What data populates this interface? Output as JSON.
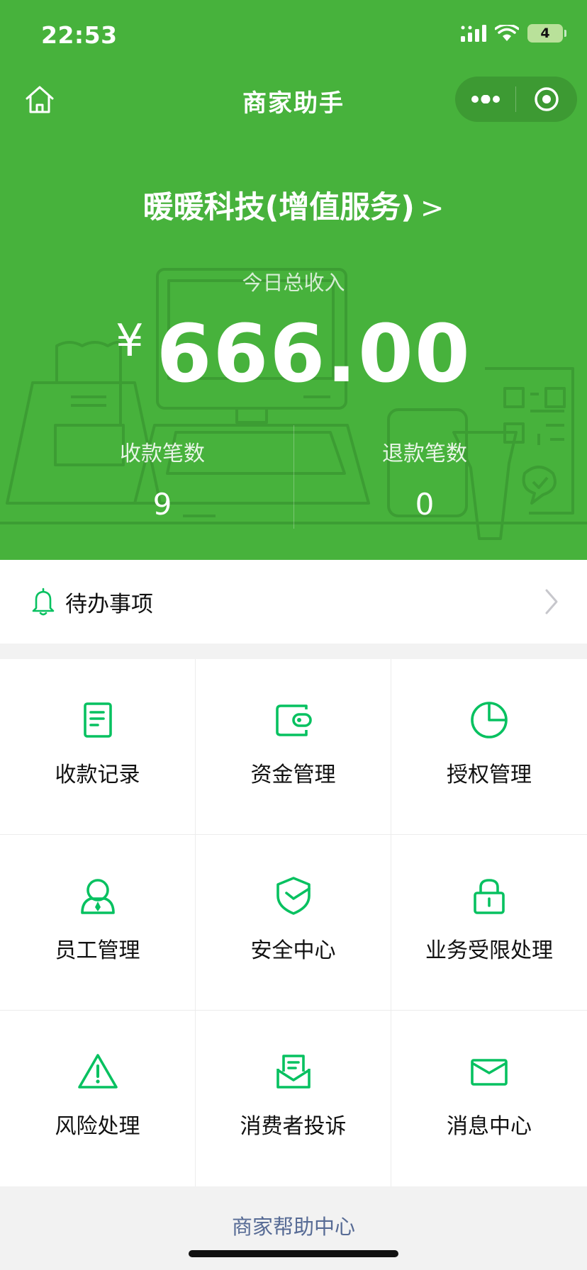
{
  "status_bar": {
    "time": "22:53",
    "battery": "4"
  },
  "nav": {
    "title": "商家助手"
  },
  "merchant": {
    "name": "暖暖科技(增值服务)",
    "chevron": ">"
  },
  "income": {
    "label": "今日总收入",
    "currency": "¥",
    "amount": "666.00"
  },
  "stats": {
    "payments_label": "收款笔数",
    "payments_value": "9",
    "refunds_label": "退款笔数",
    "refunds_value": "0"
  },
  "todo": {
    "label": "待办事项"
  },
  "grid": {
    "items": [
      {
        "label": "收款记录",
        "icon": "receipt-icon"
      },
      {
        "label": "资金管理",
        "icon": "wallet-icon"
      },
      {
        "label": "授权管理",
        "icon": "pie-chart-icon"
      },
      {
        "label": "员工管理",
        "icon": "staff-icon"
      },
      {
        "label": "安全中心",
        "icon": "shield-icon"
      },
      {
        "label": "业务受限处理",
        "icon": "lock-icon"
      },
      {
        "label": "风险处理",
        "icon": "warning-icon"
      },
      {
        "label": "消费者投诉",
        "icon": "complaint-mail-icon"
      },
      {
        "label": "消息中心",
        "icon": "envelope-icon"
      }
    ]
  },
  "footer": {
    "help_link": "商家帮助中心"
  },
  "colors": {
    "header_green": "#47b23c",
    "icon_green": "#07c160",
    "link_blue": "#576b95"
  }
}
